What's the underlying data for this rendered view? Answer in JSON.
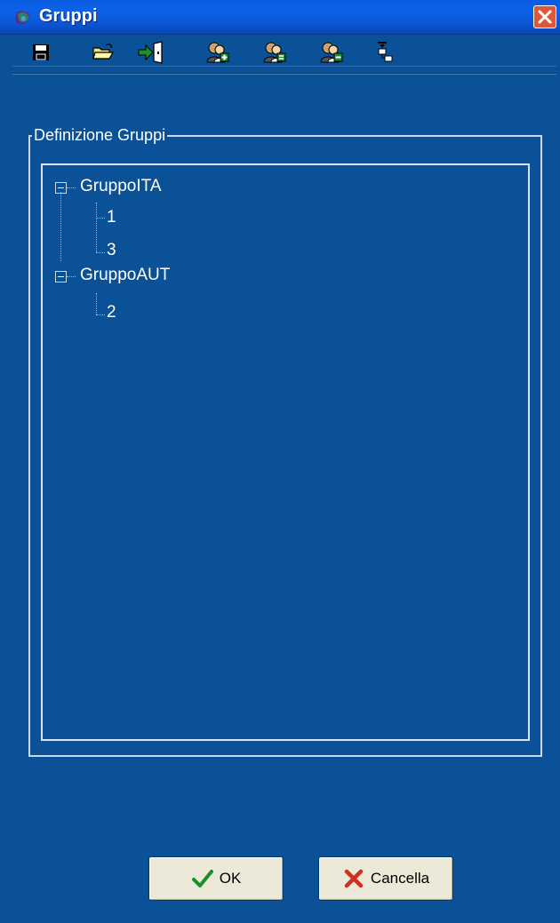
{
  "window": {
    "title": "Gruppi",
    "app_icon": "app-logo-icon",
    "close_icon": "close-icon",
    "accent": "#0a5197"
  },
  "toolbar": {
    "buttons": [
      {
        "name": "save-button",
        "icon": "floppy-disk-icon"
      },
      {
        "name": "open-button",
        "icon": "open-folder-icon"
      },
      {
        "name": "exit-button",
        "icon": "exit-door-icon"
      },
      {
        "name": "add-group-button",
        "icon": "users-add-icon"
      },
      {
        "name": "edit-group-button",
        "icon": "users-edit-icon"
      },
      {
        "name": "remove-group-button",
        "icon": "users-remove-icon"
      },
      {
        "name": "tree-structure-button",
        "icon": "tree-structure-icon"
      }
    ]
  },
  "groupbox": {
    "label": "Definizione Gruppi"
  },
  "tree": {
    "groups": [
      {
        "label": "GruppoITA",
        "children": [
          "1",
          "3"
        ]
      },
      {
        "label": "GruppoAUT",
        "children": [
          "2"
        ]
      }
    ]
  },
  "buttons": {
    "ok_label": "OK",
    "cancel_label": "Cancella"
  }
}
